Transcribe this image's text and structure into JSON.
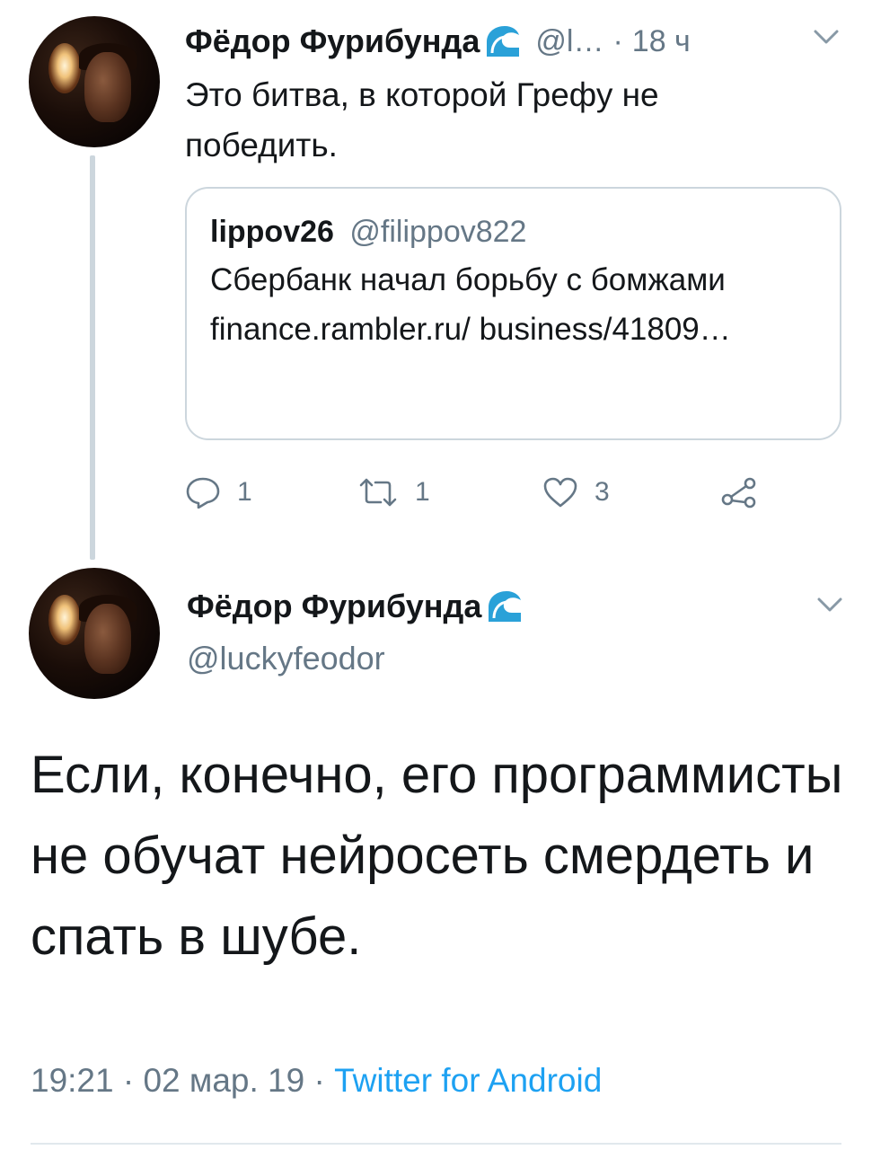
{
  "thread": {
    "tweet1": {
      "author_name": "Фёдор Фурибунда",
      "author_handle": "@l…",
      "separator": "·",
      "time": "18 ч",
      "text": "Это битва, в которой Грефу не победить.",
      "quote": {
        "name": "lippov26",
        "handle": "@filippov822",
        "text": "Сбербанк начал борьбу с бомжами finance.rambler.ru/ business/41809…"
      },
      "actions": {
        "replies": "1",
        "retweets": "1",
        "likes": "3"
      }
    },
    "tweet2": {
      "author_name": "Фёдор Фурибунда",
      "author_handle": "@luckyfeodor",
      "text": "Если, конечно, его программисты не обучат нейросеть смердеть и спать в шубе.",
      "timestamp": "19:21 · 02 мар. 19 · ",
      "source": "Twitter for Android"
    }
  },
  "icons": {
    "name_badge": "wave-icon",
    "menu": "chevron-down-icon",
    "reply": "reply-icon",
    "retweet": "retweet-icon",
    "like": "heart-icon",
    "share": "share-icon"
  },
  "colors": {
    "text": "#14171a",
    "muted": "#657786",
    "link": "#1da1f2",
    "border": "#ccd6dd"
  }
}
